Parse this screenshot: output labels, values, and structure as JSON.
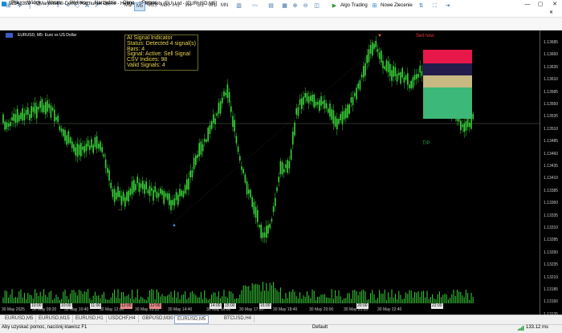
{
  "window": {
    "title": "52348391 - ICMarketsEU-Demo: Rachunek Demo - Hedge - IC Markets (EU) Ltd - [EURUSD,M5]",
    "min": "—",
    "max": "▢",
    "close": "✕"
  },
  "menu": [
    "Plik",
    "Widok",
    "Wstaw",
    "Wykresy",
    "Narzędzia",
    "Okno",
    "Pomoc"
  ],
  "toolbar": {
    "timeframes": [
      "M1",
      "M5",
      "M15",
      "M30",
      "H1",
      "H4",
      "D1",
      "W1",
      "MN"
    ],
    "selected_timeframe": "M5",
    "algo_trading": "Algo Trading",
    "new_order": "Nowe Zlecenie"
  },
  "chart": {
    "label": "EURUSD, M5:  Euro vs US Dollar",
    "info_lines": [
      "AI Signal Indicator",
      "Status: Detected 4 signal(s)",
      "Bars: 4",
      "Signal: Active: Sell Signal",
      "CSV Indices: 98",
      "Valid Signals: 4"
    ],
    "sell_now": "Sell now",
    "tp": "T/P",
    "price_ticks": [
      "1.13685",
      "1.13660",
      "1.13635",
      "1.13610",
      "1.13585",
      "1.13560",
      "1.13535",
      "1.13510",
      "1.13485",
      "1.13460",
      "1.13435",
      "1.13410",
      "1.13385",
      "1.13360",
      "1.13335",
      "1.13310",
      "1.13285",
      "1.13260",
      "1.13235",
      "1.13210",
      "1.13185",
      "1.13160",
      "1.13135",
      "1.13110"
    ],
    "time_ticks": [
      "30 May 2025",
      "30 May 09:20",
      "30 May 10:40",
      "30 May 12:00",
      "30 May 13:20",
      "30 May 14:40",
      "30 May 16:00",
      "30 May 17:20",
      "30 May 18:40",
      "30 May 20:00",
      "30 May 21:20",
      "30 May 22:40"
    ],
    "time_boxes": [
      "10:00",
      "10:00",
      "11:00",
      "12:00",
      "12:00",
      "14:00",
      "15:00",
      "16:00",
      "20:00",
      "22:00"
    ],
    "zone_colors": {
      "red": "#e8184a",
      "navy": "#241c4a",
      "tan": "#c8b882",
      "green": "#3cb878"
    },
    "candle_color": "#39d439"
  },
  "tabs": [
    "EURUSD,M5",
    "EURUSD,M15",
    "EURUSD,H1",
    "USDCHF,H4",
    "GBPUSD,M30",
    "EURUSD,M5",
    "BTCUSD,H4"
  ],
  "active_tab_index": 5,
  "status": {
    "help": "Aby uzyskać pomoc, naciśnij klawisz F1",
    "profile": "Default",
    "ping": "133.12 ms"
  }
}
